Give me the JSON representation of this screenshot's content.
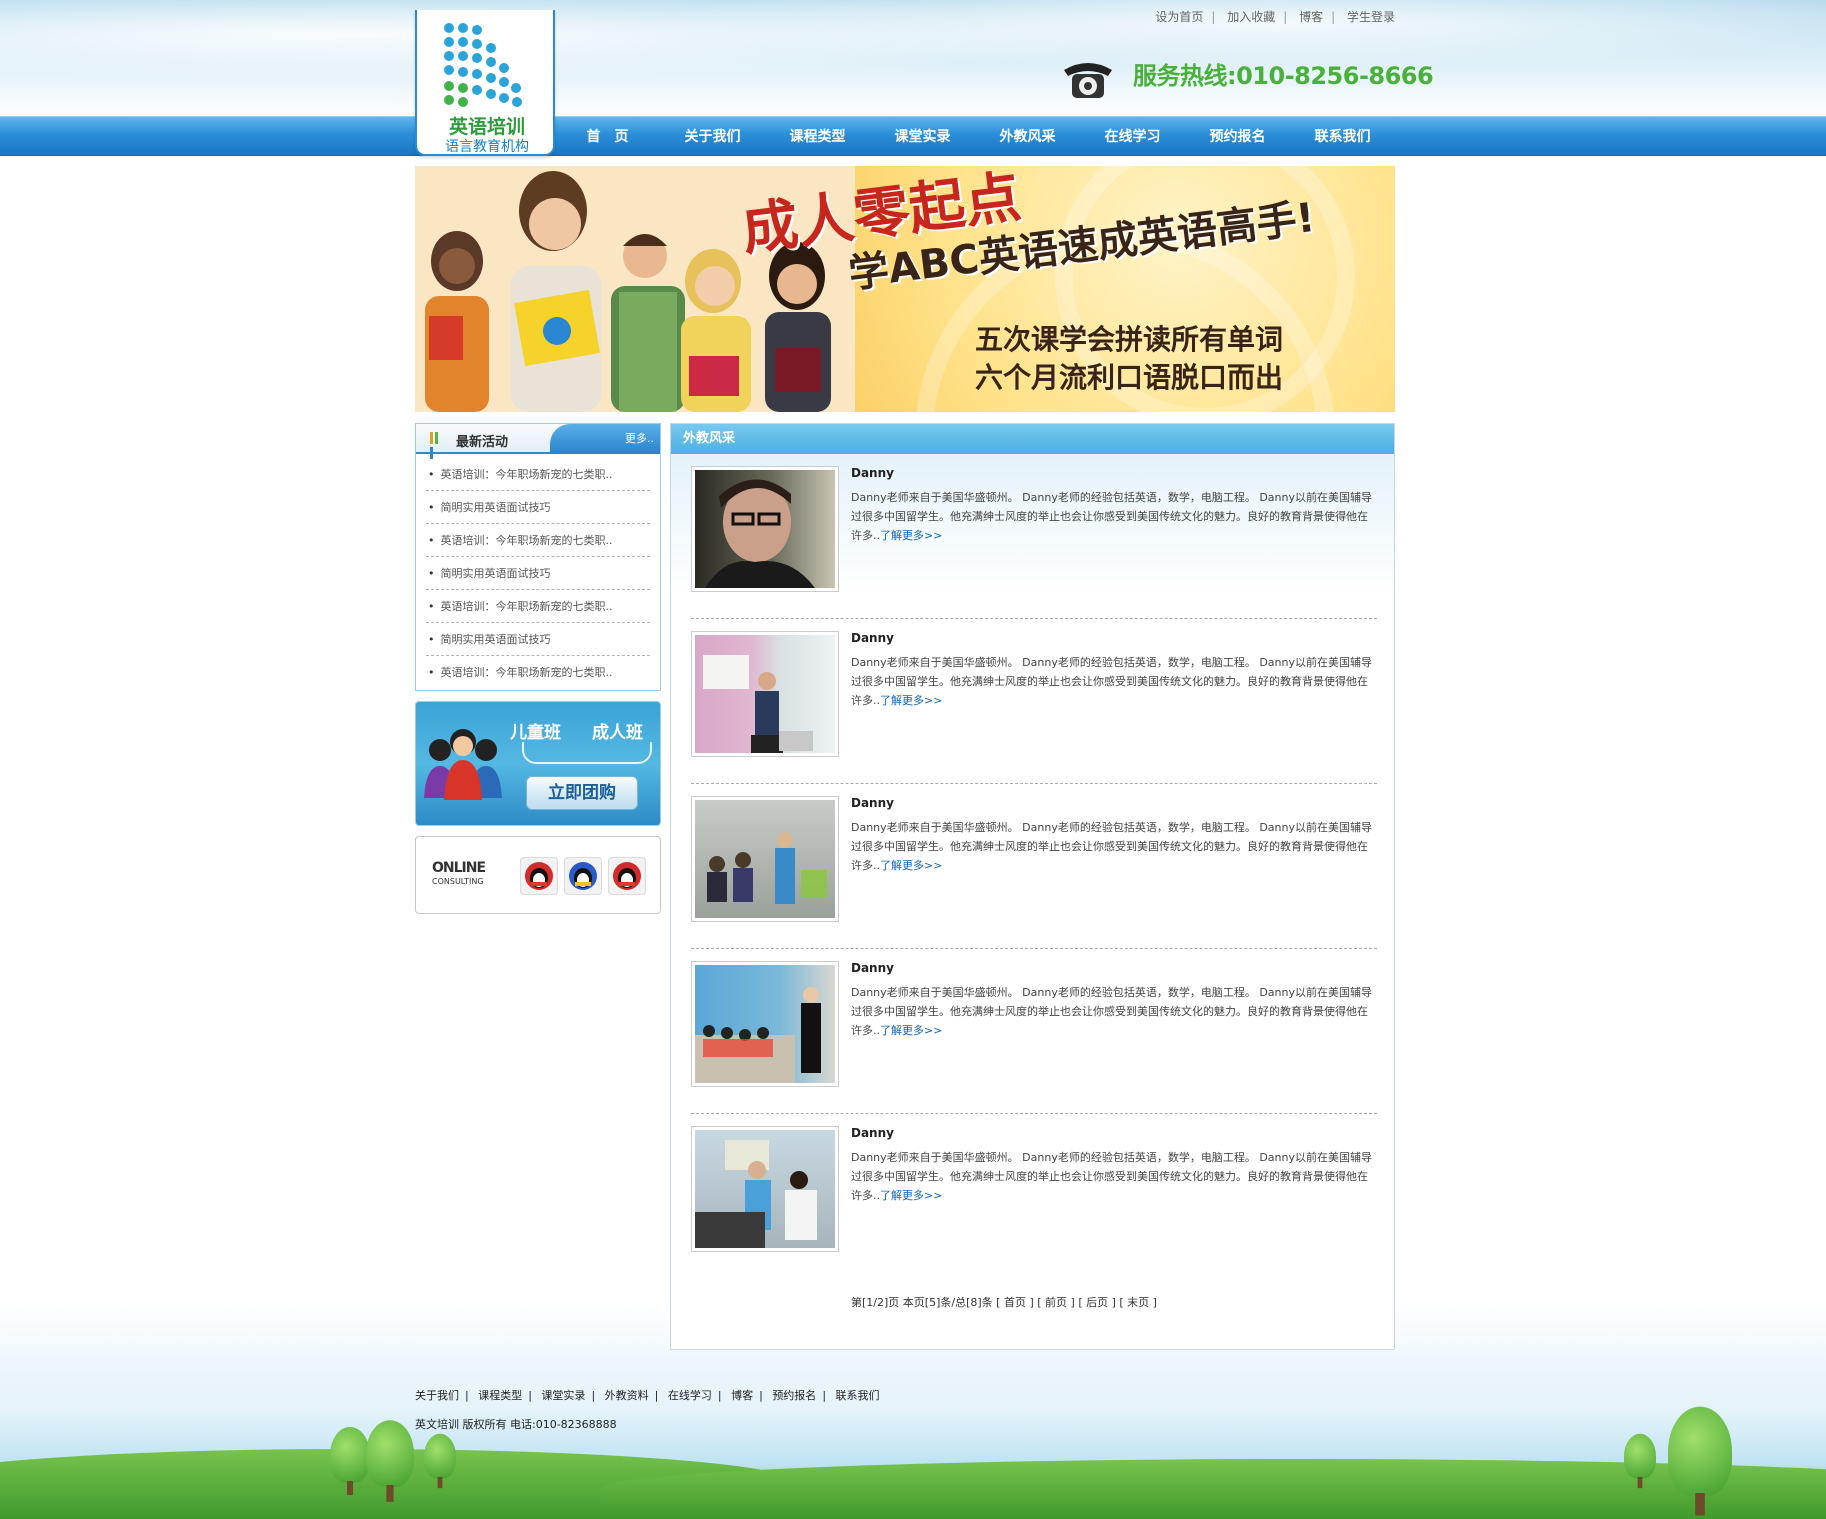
{
  "header": {
    "top_links": [
      "设为首页",
      "加入收藏",
      "博客",
      "学生登录"
    ],
    "logo_title": "英语培训",
    "logo_subtitle": "语言教育机构",
    "hotline": "服务热线:010-8256-8666"
  },
  "nav": {
    "items": [
      "首　页",
      "关于我们",
      "课程类型",
      "课堂实录",
      "外教风采",
      "在线学习",
      "预约报名",
      "联系我们"
    ]
  },
  "banner": {
    "headline": "成人零起点",
    "subheadline": "学ABC英语速成英语高手!",
    "line1": "五次课学会拼读所有单词",
    "line2": "六个月流利口语脱口而出"
  },
  "sidebar": {
    "news_title": "最新活动",
    "news_more": "更多..",
    "news_items": [
      "英语培训：今年职场新宠的七类职..",
      "简明实用英语面试技巧",
      "英语培训：今年职场新宠的七类职..",
      "简明实用英语面试技巧",
      "英语培训：今年职场新宠的七类职..",
      "简明实用英语面试技巧",
      "英语培训：今年职场新宠的七类职.."
    ],
    "promo_kids": "儿童班",
    "promo_adults": "成人班",
    "promo_button": "立即团购",
    "online_title": "ONLINE",
    "online_sub": "CONSULTING"
  },
  "main": {
    "title": "外教风采",
    "teachers": [
      {
        "name": "Danny",
        "desc": "Danny老师来自于美国华盛顿州。 Danny老师的经验包括英语，数学，电脑工程。 Danny以前在美国辅导过很多中国留学生。他充满绅士风度的举止也会让你感受到美国传统文化的魅力。良好的教育背景使得他在许多..",
        "more": "了解更多>>"
      },
      {
        "name": "Danny",
        "desc": "Danny老师来自于美国华盛顿州。 Danny老师的经验包括英语，数学，电脑工程。 Danny以前在美国辅导过很多中国留学生。他充满绅士风度的举止也会让你感受到美国传统文化的魅力。良好的教育背景使得他在许多..",
        "more": "了解更多>>"
      },
      {
        "name": "Danny",
        "desc": "Danny老师来自于美国华盛顿州。 Danny老师的经验包括英语，数学，电脑工程。 Danny以前在美国辅导过很多中国留学生。他充满绅士风度的举止也会让你感受到美国传统文化的魅力。良好的教育背景使得他在许多..",
        "more": "了解更多>>"
      },
      {
        "name": "Danny",
        "desc": "Danny老师来自于美国华盛顿州。 Danny老师的经验包括英语，数学，电脑工程。 Danny以前在美国辅导过很多中国留学生。他充满绅士风度的举止也会让你感受到美国传统文化的魅力。良好的教育背景使得他在许多..",
        "more": "了解更多>>"
      },
      {
        "name": "Danny",
        "desc": "Danny老师来自于美国华盛顿州。 Danny老师的经验包括英语，数学，电脑工程。 Danny以前在美国辅导过很多中国留学生。他充满绅士风度的举止也会让你感受到美国传统文化的魅力。良好的教育背景使得他在许多..",
        "more": "了解更多>>"
      }
    ],
    "pager": {
      "info": "第[1/2]页 本页[5]条/总[8]条",
      "first": "[ 首页 ]",
      "prev": "[ 前页 ]",
      "next": "[ 后页 ]",
      "last": "[ 末页 ]"
    }
  },
  "footer": {
    "links": [
      "关于我们",
      "课程类型",
      "课堂实录",
      "外教资料",
      "在线学习",
      "博客",
      "预约报名",
      "联系我们"
    ],
    "copyright": "英文培训 版权所有 电话:010-82368888"
  }
}
